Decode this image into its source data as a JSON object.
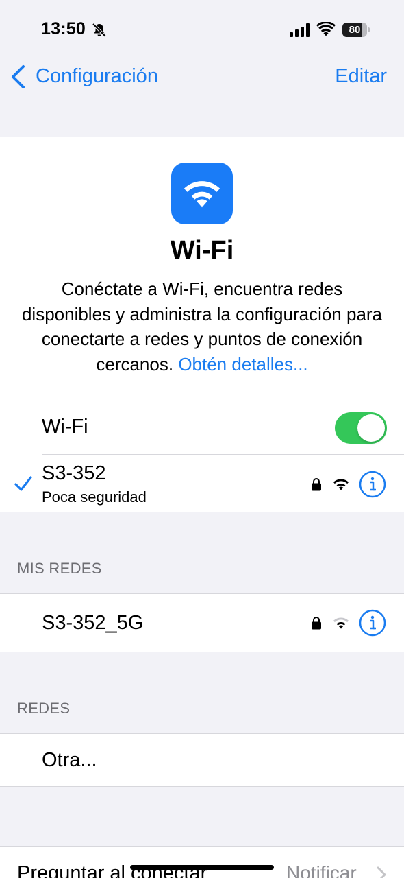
{
  "status_bar": {
    "time": "13:50",
    "battery": "80",
    "battery_level": 0.8
  },
  "nav": {
    "back_label": "Configuración",
    "edit_label": "Editar"
  },
  "header": {
    "title": "Wi-Fi",
    "description": "Conéctate a Wi-Fi, encuentra redes disponibles y administra la configuración para conectarte a redes y puntos de conexión cercanos.",
    "learn_more": "Obtén detalles..."
  },
  "wifi_toggle": {
    "label": "Wi-Fi",
    "enabled": true
  },
  "connected_network": {
    "name": "S3-352",
    "subtitle": "Poca seguridad"
  },
  "my_networks": {
    "header": "MIS REDES",
    "items": [
      {
        "name": "S3-352_5G"
      }
    ]
  },
  "networks": {
    "header": "REDES",
    "other_label": "Otra..."
  },
  "ask_to_join": {
    "label": "Preguntar al conectar",
    "value": "Notificar"
  },
  "colors": {
    "accent": "#1a7cf0",
    "toggle_on": "#34c759",
    "background": "#f2f2f7"
  }
}
